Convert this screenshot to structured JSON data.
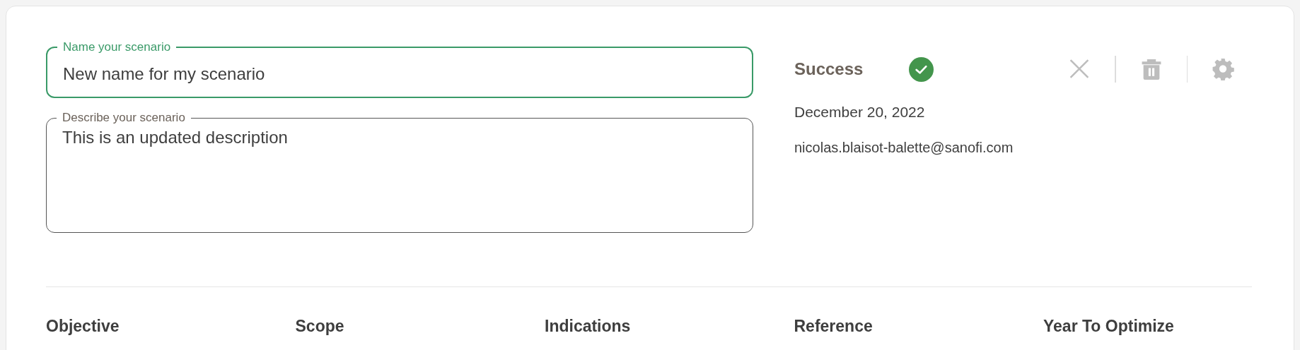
{
  "name_field": {
    "label": "Name your scenario",
    "value": "New name for my scenario",
    "focused": true
  },
  "description_field": {
    "label": "Describe your scenario",
    "value": "This is an updated description",
    "focused": false
  },
  "status": {
    "label": "Success",
    "ok": true
  },
  "actions": [
    {
      "kind": "close"
    },
    {
      "kind": "delete"
    },
    {
      "kind": "settings"
    }
  ],
  "date": "December 20, 2022",
  "author": "nicolas.blaisot-balette@sanofi.com",
  "columns": [
    "Objective",
    "Scope",
    "Indications",
    "Reference",
    "Year To Optimize"
  ]
}
